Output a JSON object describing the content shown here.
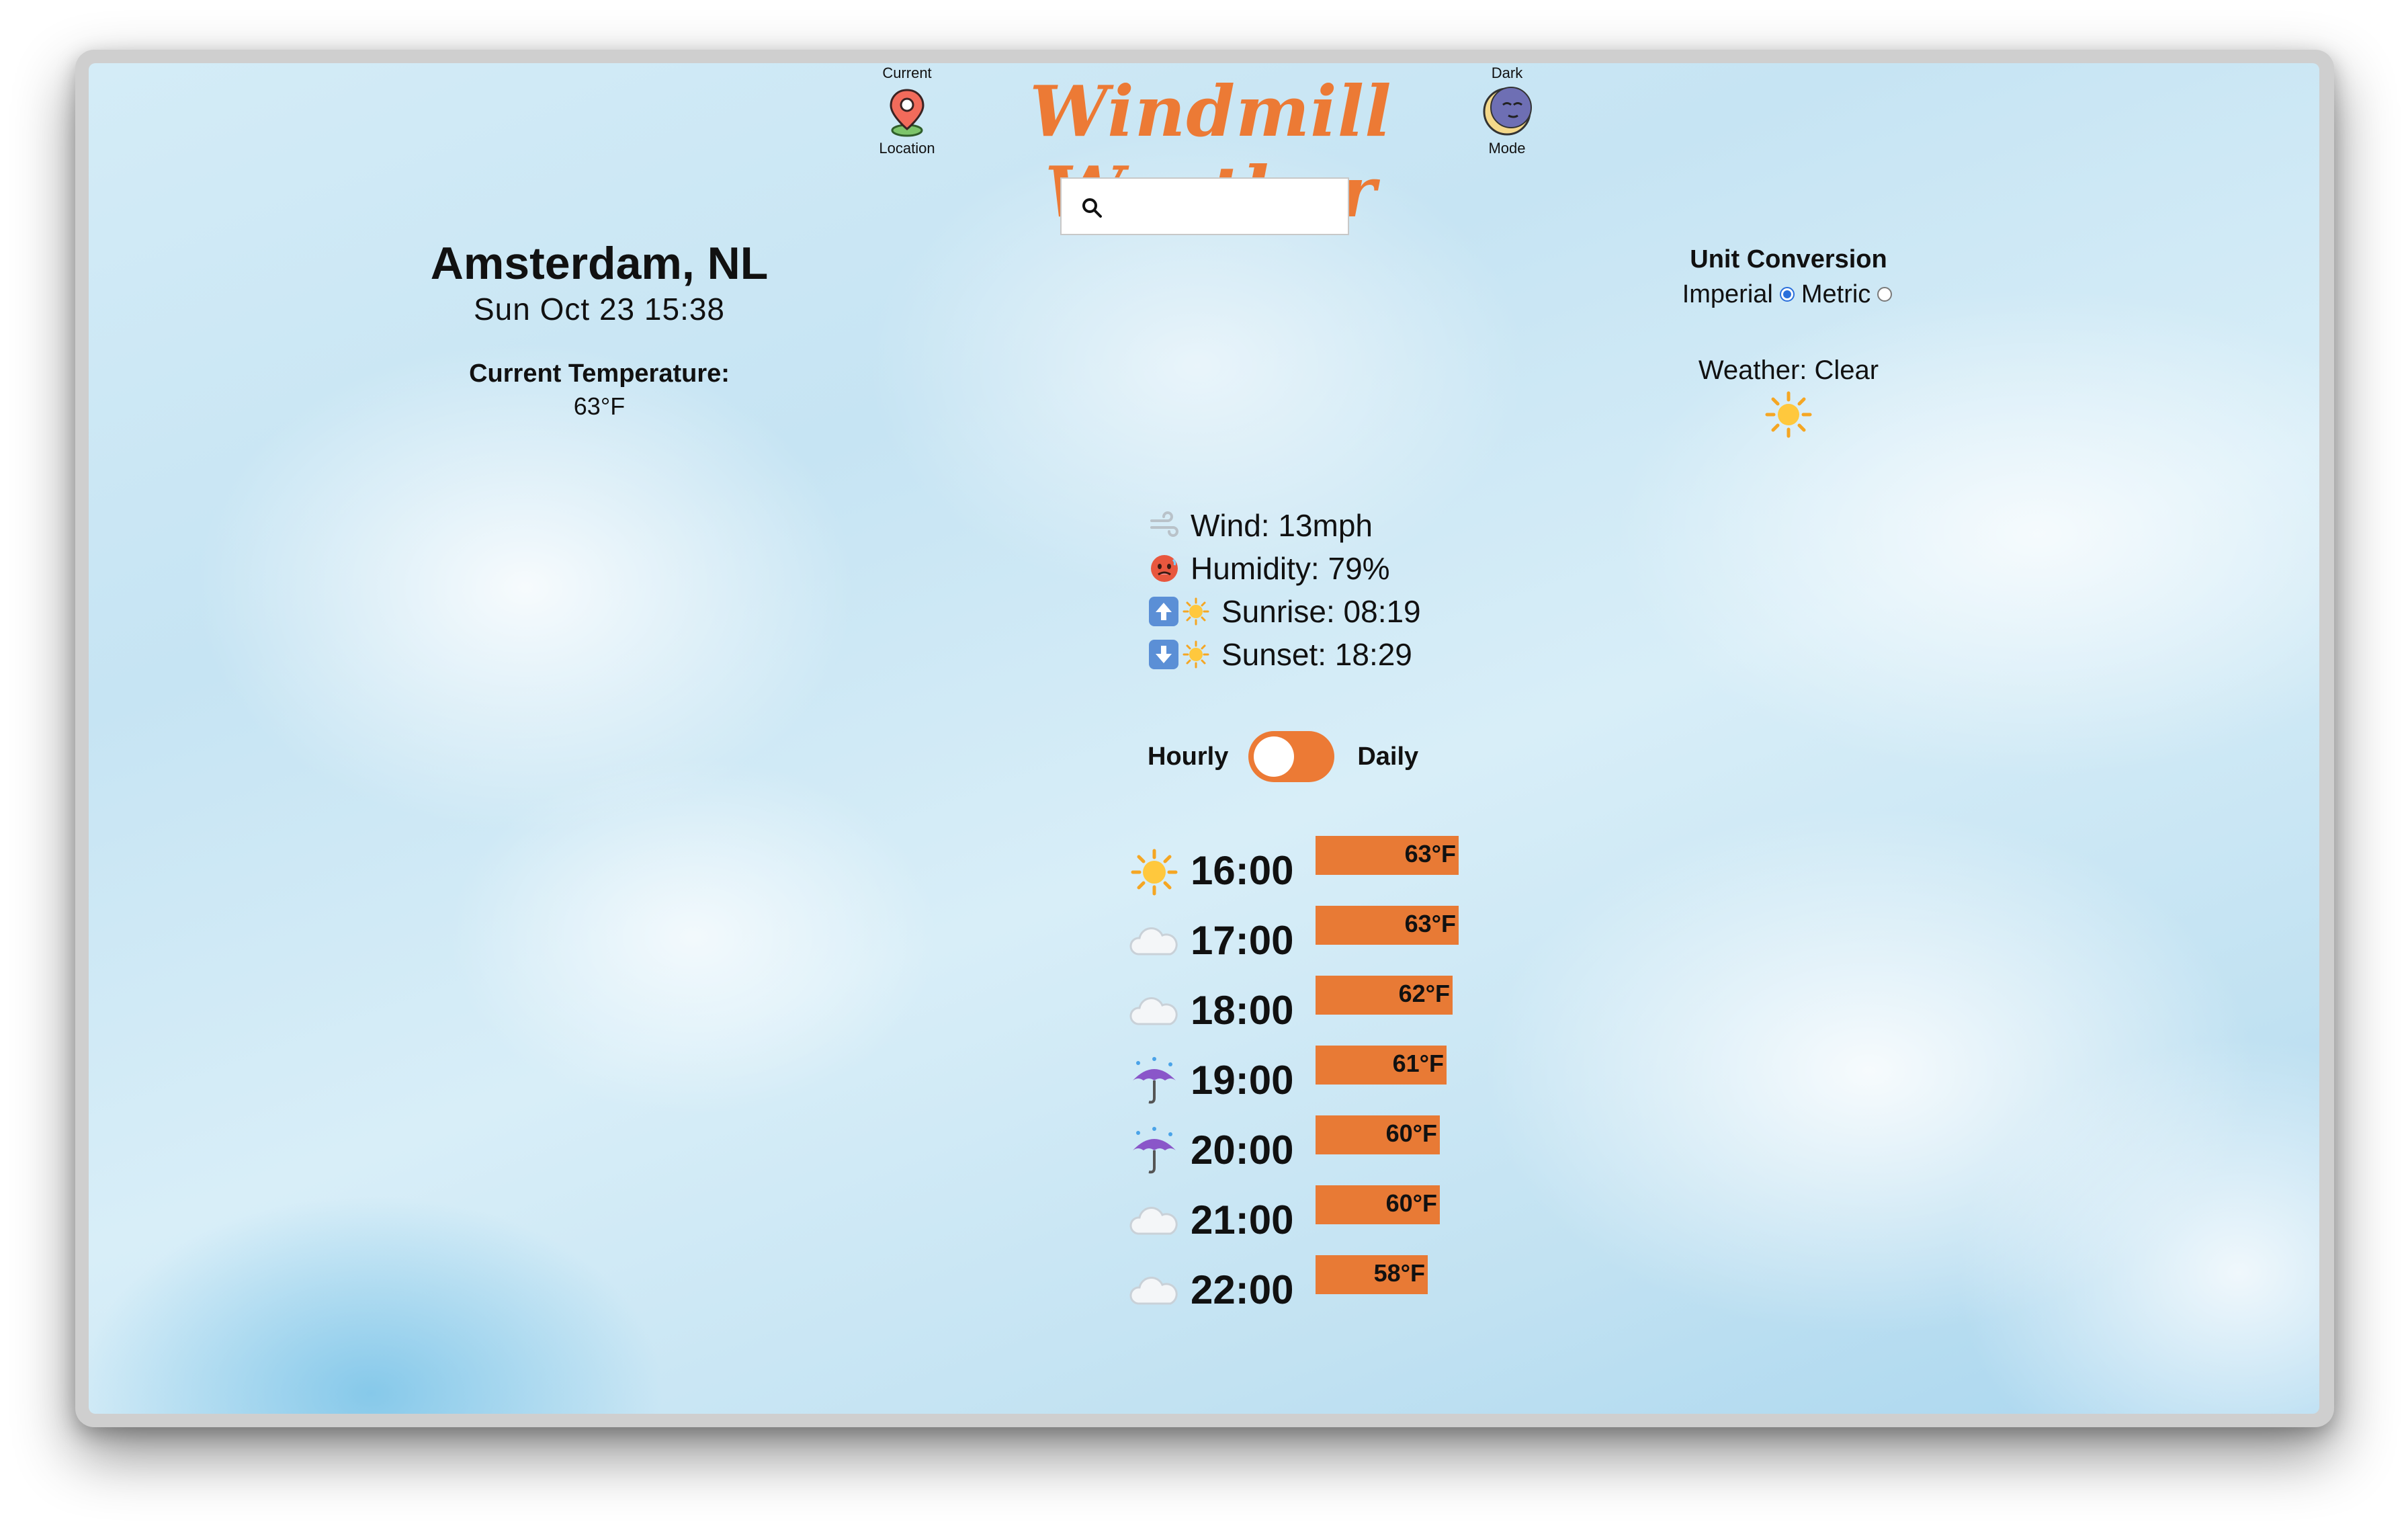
{
  "header": {
    "title": "Windmill Weather",
    "location_button": {
      "top_label": "Current",
      "bottom_label": "Location",
      "icon": "map-pin-icon"
    },
    "dark_mode_button": {
      "top_label": "Dark",
      "bottom_label": "Mode",
      "icon": "moon-icon"
    }
  },
  "search": {
    "value": "",
    "placeholder": "",
    "icon": "search-icon"
  },
  "city": {
    "name": "Amsterdam, NL",
    "datetime": "Sun Oct 23 15:38",
    "current_temp_label": "Current Temperature:",
    "current_temp": "63°F"
  },
  "units": {
    "title": "Unit Conversion",
    "imperial_label": "Imperial",
    "metric_label": "Metric",
    "selected": "Imperial"
  },
  "weather": {
    "label": "Weather: Clear",
    "icon": "sun-icon"
  },
  "details": [
    {
      "icon": "wind-icon",
      "text": "Wind: 13mph"
    },
    {
      "icon": "hot-face-icon",
      "text": "Humidity: 79%"
    },
    {
      "icon": "sunrise-icon",
      "text": "Sunrise: 08:19"
    },
    {
      "icon": "sunset-icon",
      "text": "Sunset: 18:29"
    }
  ],
  "toggle": {
    "left_label": "Hourly",
    "right_label": "Daily",
    "selected": "Hourly"
  },
  "forecast": [
    {
      "icon": "sun-icon",
      "time": "16:00",
      "temp": "63°F",
      "value": 63
    },
    {
      "icon": "cloud-icon",
      "time": "17:00",
      "temp": "63°F",
      "value": 63
    },
    {
      "icon": "cloud-icon",
      "time": "18:00",
      "temp": "62°F",
      "value": 62
    },
    {
      "icon": "umbrella-rain-icon",
      "time": "19:00",
      "temp": "61°F",
      "value": 61
    },
    {
      "icon": "umbrella-rain-icon",
      "time": "20:00",
      "temp": "60°F",
      "value": 60
    },
    {
      "icon": "cloud-icon",
      "time": "21:00",
      "temp": "60°F",
      "value": 60
    },
    {
      "icon": "cloud-icon",
      "time": "22:00",
      "temp": "58°F",
      "value": 58
    }
  ],
  "colors": {
    "accent": "#ec7a35",
    "bar": "#e87a35",
    "radio": "#2a6fdb"
  }
}
